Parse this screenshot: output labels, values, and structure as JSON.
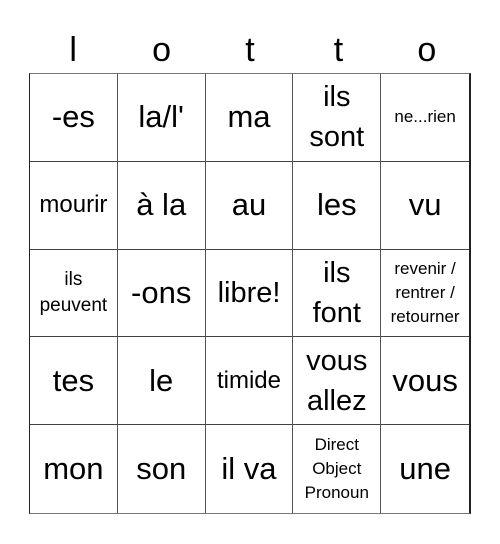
{
  "title_letters": [
    "l",
    "o",
    "t",
    "t",
    "o"
  ],
  "cells": [
    {
      "text": "-es",
      "size": "xl"
    },
    {
      "text": "la/l'",
      "size": "xl"
    },
    {
      "text": "ma",
      "size": "xl"
    },
    {
      "text": "ils\nsont",
      "size": "lg"
    },
    {
      "text": "ne...rien",
      "size": "xs"
    },
    {
      "text": "mourir",
      "size": "md"
    },
    {
      "text": "à la",
      "size": "xl"
    },
    {
      "text": "au",
      "size": "xl"
    },
    {
      "text": "les",
      "size": "xl"
    },
    {
      "text": "vu",
      "size": "xl"
    },
    {
      "text": "ils\npeuvent",
      "size": "sm"
    },
    {
      "text": "-ons",
      "size": "xl"
    },
    {
      "text": "libre!",
      "size": "lg"
    },
    {
      "text": "ils\nfont",
      "size": "lg"
    },
    {
      "text": "revenir /\nrentrer /\nretourner",
      "size": "xs"
    },
    {
      "text": "tes",
      "size": "xl"
    },
    {
      "text": "le",
      "size": "xl"
    },
    {
      "text": "timide",
      "size": "md"
    },
    {
      "text": "vous\nallez",
      "size": "lg"
    },
    {
      "text": "vous",
      "size": "xl"
    },
    {
      "text": "mon",
      "size": "xl"
    },
    {
      "text": "son",
      "size": "xl"
    },
    {
      "text": "il va",
      "size": "xl"
    },
    {
      "text": "Direct\nObject\nPronoun",
      "size": "xs"
    },
    {
      "text": "une",
      "size": "xl"
    }
  ]
}
